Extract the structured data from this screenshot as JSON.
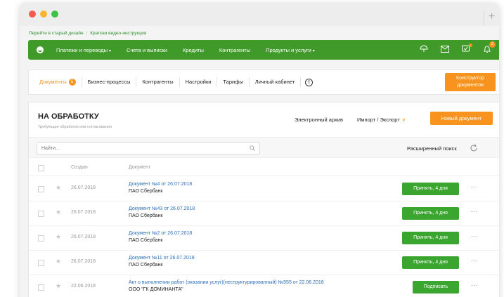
{
  "top_links": {
    "old_design": "Перейти в старый дизайн",
    "video": "Краткая видео-инструкция"
  },
  "nav": {
    "items": [
      {
        "label": "Платежи и переводы",
        "caret": true
      },
      {
        "label": "Счета и выписки",
        "caret": false
      },
      {
        "label": "Кредиты",
        "caret": false
      },
      {
        "label": "Контрагенты",
        "caret": false
      },
      {
        "label": "Продукты и услуги",
        "caret": true
      }
    ],
    "caret_glyph": "▾",
    "notifications_count": "2",
    "icons": [
      "umbrella-icon",
      "mail-icon",
      "chat-icon",
      "bell-icon"
    ]
  },
  "subnav": {
    "documents_label": "Документы",
    "documents_count": "5",
    "items": [
      "Бизнес-процессы",
      "Контрагенты",
      "Настройки",
      "Тарифы",
      "Личный кабинет"
    ],
    "info_glyph": "!",
    "constructor_button": "Конструктор документов"
  },
  "card": {
    "title": "НА ОБРАБОТКУ",
    "subtitle": "Требующие обработки или согласования",
    "archive_link": "Электронный архив",
    "import_export": "Импорт / Экспорт",
    "import_chevron": "∨",
    "new_document_button": "Новый документ"
  },
  "filter": {
    "search_placeholder": "Найти...",
    "advanced_search": "Расширенный поиск"
  },
  "table": {
    "headers": {
      "created": "Создан",
      "document": "Документ"
    },
    "rows": [
      {
        "date": "26.07.2018",
        "title": "Документ №4 от 26.07.2018",
        "org": "ПАО Сбербанк",
        "action": "Принять, 4 дня",
        "action_type": "accept"
      },
      {
        "date": "26.07.2018",
        "title": "Документ №43 от 26.07.2018",
        "org": "ПАО Сбербанк",
        "action": "Принять, 4 дня",
        "action_type": "accept"
      },
      {
        "date": "26.07.2018",
        "title": "Документ №2 от 26.07.2018",
        "org": "ПАО Сбербанк",
        "action": "Принять, 4 дня",
        "action_type": "accept"
      },
      {
        "date": "26.07.2018",
        "title": "Документ №11 от 26.07.2018",
        "org": "ПАО Сбербанк",
        "action": "Принять, 4 дня",
        "action_type": "accept"
      },
      {
        "date": "22.06.2018",
        "title": "Акт о выполнении работ (оказании услуг)(неструктурированный) №555 от 22.06.2018",
        "org": "ООО \"ГК ДОМИНАНТА\"",
        "action": "Подписать",
        "action_type": "sign"
      }
    ],
    "star_glyph": "★",
    "more_glyph": "···"
  },
  "colors": {
    "brand_green": "#3f9a2a",
    "accent_orange": "#f7931e",
    "button_green": "#3aa52f",
    "link_blue": "#2c6fb7"
  }
}
